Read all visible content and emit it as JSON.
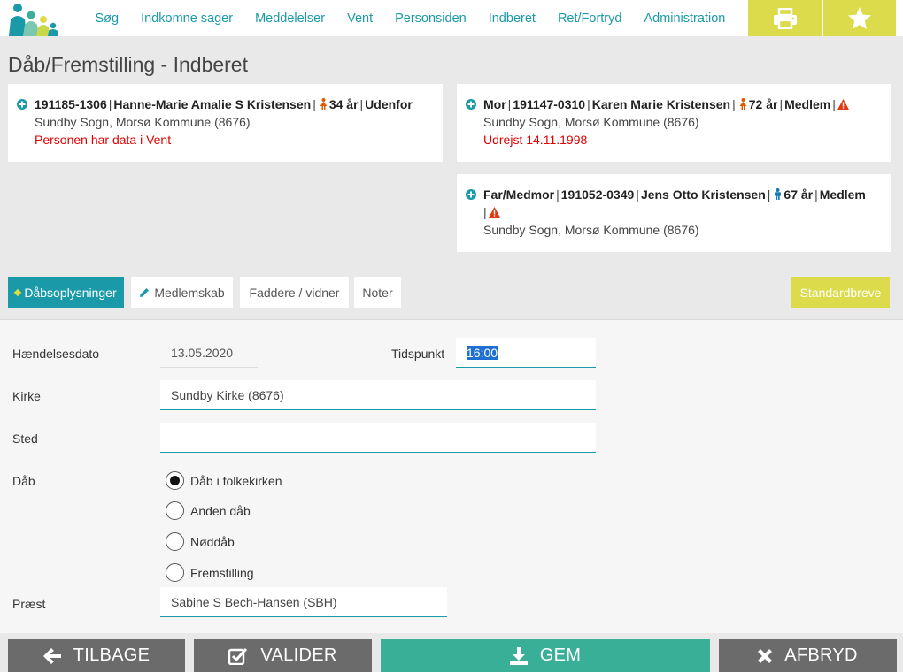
{
  "nav": {
    "links": [
      "Søg",
      "Indkomne sager",
      "Meddelelser",
      "Vent",
      "Personsiden",
      "Indberet",
      "Ret/Fortryd",
      "Administration"
    ],
    "print_icon": "printer-icon",
    "star_icon": "star-icon"
  },
  "page": {
    "title": "Dåb/Fremstilling - Indberet"
  },
  "persons": {
    "child": {
      "cpr": "191185-1306",
      "name": "Hanne-Marie Amalie S Kristensen",
      "age": "34 år",
      "status": "Udenfor",
      "address": "Sundby Sogn, Morsø Kommune (8676)",
      "note": "Personen har data i Vent"
    },
    "mother": {
      "role": "Mor",
      "cpr": "191147-0310",
      "name": "Karen Marie Kristensen",
      "age": "72 år",
      "status": "Medlem",
      "address": "Sundby Sogn, Morsø Kommune (8676)",
      "note": "Udrejst 14.11.1998"
    },
    "father": {
      "role": "Far/Medmor",
      "cpr": "191052-0349",
      "name": "Jens Otto Kristensen",
      "age": "67 år",
      "status": "Medlem",
      "address": "Sundby Sogn, Morsø Kommune (8676)"
    },
    "separator": "|"
  },
  "tabs": {
    "items": [
      "Dåbsoplysninger",
      "Medlemskab",
      "Faddere / vidner",
      "Noter"
    ],
    "standard_letters": "Standardbreve"
  },
  "form": {
    "date_label": "Hændelsesdato",
    "date_value": "13.05.2020",
    "time_label": "Tidspunkt",
    "time_value": "16:00",
    "church_label": "Kirke",
    "church_value": "Sundby Kirke (8676)",
    "place_label": "Sted",
    "place_value": "",
    "baptism_label": "Dåb",
    "baptism_options": [
      "Dåb i folkekirken",
      "Anden dåb",
      "Nøddåb",
      "Fremstilling"
    ],
    "baptism_selected": "Dåb i folkekirken",
    "priest_label": "Præst",
    "priest_value": "Sabine S Bech-Hansen (SBH)"
  },
  "actions": {
    "back": "TILBAGE",
    "validate": "VALIDER",
    "save": "GEM",
    "cancel": "AFBRYD"
  },
  "colors": {
    "teal": "#1a9aa8",
    "yellow": "#dbdb4c",
    "green": "#3aaf98",
    "gray": "#6b6b6b",
    "red": "#e10000"
  }
}
